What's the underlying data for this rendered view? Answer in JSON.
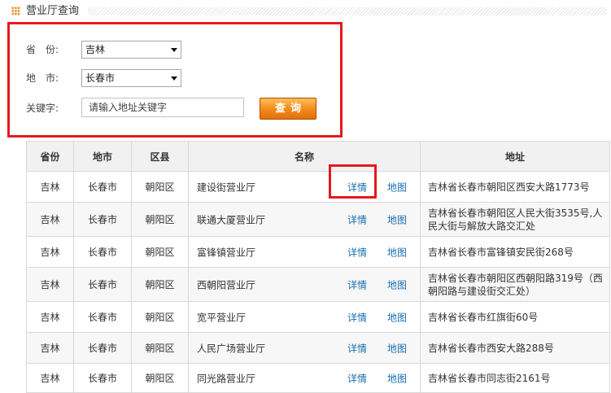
{
  "title": "营业厅查询",
  "form": {
    "province_label": "省　份:",
    "province_value": "吉林",
    "city_label": "地　市:",
    "city_value": "长春市",
    "keyword_label": "关键字:",
    "keyword_placeholder": "请输入地址关键字",
    "query_button": "查询"
  },
  "table": {
    "headers": [
      "省份",
      "地市",
      "区县",
      "名称",
      "地址"
    ],
    "detail_link": "详情",
    "map_link": "地图",
    "rows": [
      {
        "province": "吉林",
        "city": "长春市",
        "district": "朝阳区",
        "name": "建设街营业厅",
        "address": "吉林省长春市朝阳区西安大路1773号"
      },
      {
        "province": "吉林",
        "city": "长春市",
        "district": "朝阳区",
        "name": "联通大厦营业厅",
        "address": "吉林省长春市朝阳区人民大街3535号,人民大街与解放大路交汇处"
      },
      {
        "province": "吉林",
        "city": "长春市",
        "district": "朝阳区",
        "name": "富锋镇营业厅",
        "address": "吉林省长春市富锋镇安民街268号"
      },
      {
        "province": "吉林",
        "city": "长春市",
        "district": "朝阳区",
        "name": "西朝阳营业厅",
        "address": "吉林省长春市朝阳区西朝阳路319号（西朝阳路与建设街交汇处）"
      },
      {
        "province": "吉林",
        "city": "长春市",
        "district": "朝阳区",
        "name": "宽平营业厅",
        "address": "吉林省长春市红旗街60号"
      },
      {
        "province": "吉林",
        "city": "长春市",
        "district": "朝阳区",
        "name": "人民广场营业厅",
        "address": "吉林省长春市西安大路288号"
      },
      {
        "province": "吉林",
        "city": "长春市",
        "district": "朝阳区",
        "name": "同光路营业厅",
        "address": "吉林省长春市同志街2161号"
      }
    ]
  },
  "colors": {
    "accent": "#e38a1b",
    "highlight": "#e31a1a",
    "link": "#1a6fb0",
    "button": "#f08a1a"
  }
}
